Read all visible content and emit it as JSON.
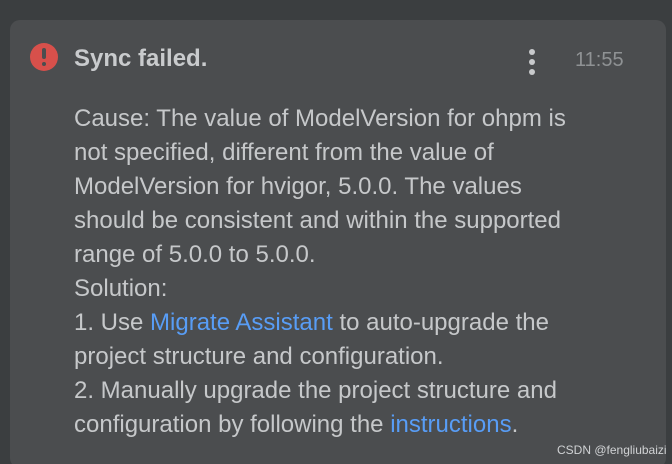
{
  "notification": {
    "title": "Sync failed.",
    "time": "11:55",
    "cause_lines": [
      "Cause: The value of ModelVersion for ohpm is",
      "not specified, different from the value of",
      "ModelVersion for hvigor, 5.0.0. The values",
      "should be consistent and within the supported",
      "range of 5.0.0 to 5.0.0."
    ],
    "solution_label": "Solution:",
    "step1": {
      "prefix": "1. Use ",
      "link": "Migrate Assistant",
      "suffix": " to auto-upgrade the",
      "line2": "project structure and configuration."
    },
    "step2": {
      "line1": "2. Manually upgrade the project structure and",
      "prefix": "configuration by following the ",
      "link": "instructions",
      "suffix": "."
    }
  },
  "watermark": "CSDN @fengliubaizi",
  "icons": {
    "status": "error-icon",
    "menu": "more-vertical-icon"
  },
  "colors": {
    "error": "#d7504b",
    "link": "#589df6",
    "panel": "#4b4d4f",
    "background": "#3b3e40"
  }
}
